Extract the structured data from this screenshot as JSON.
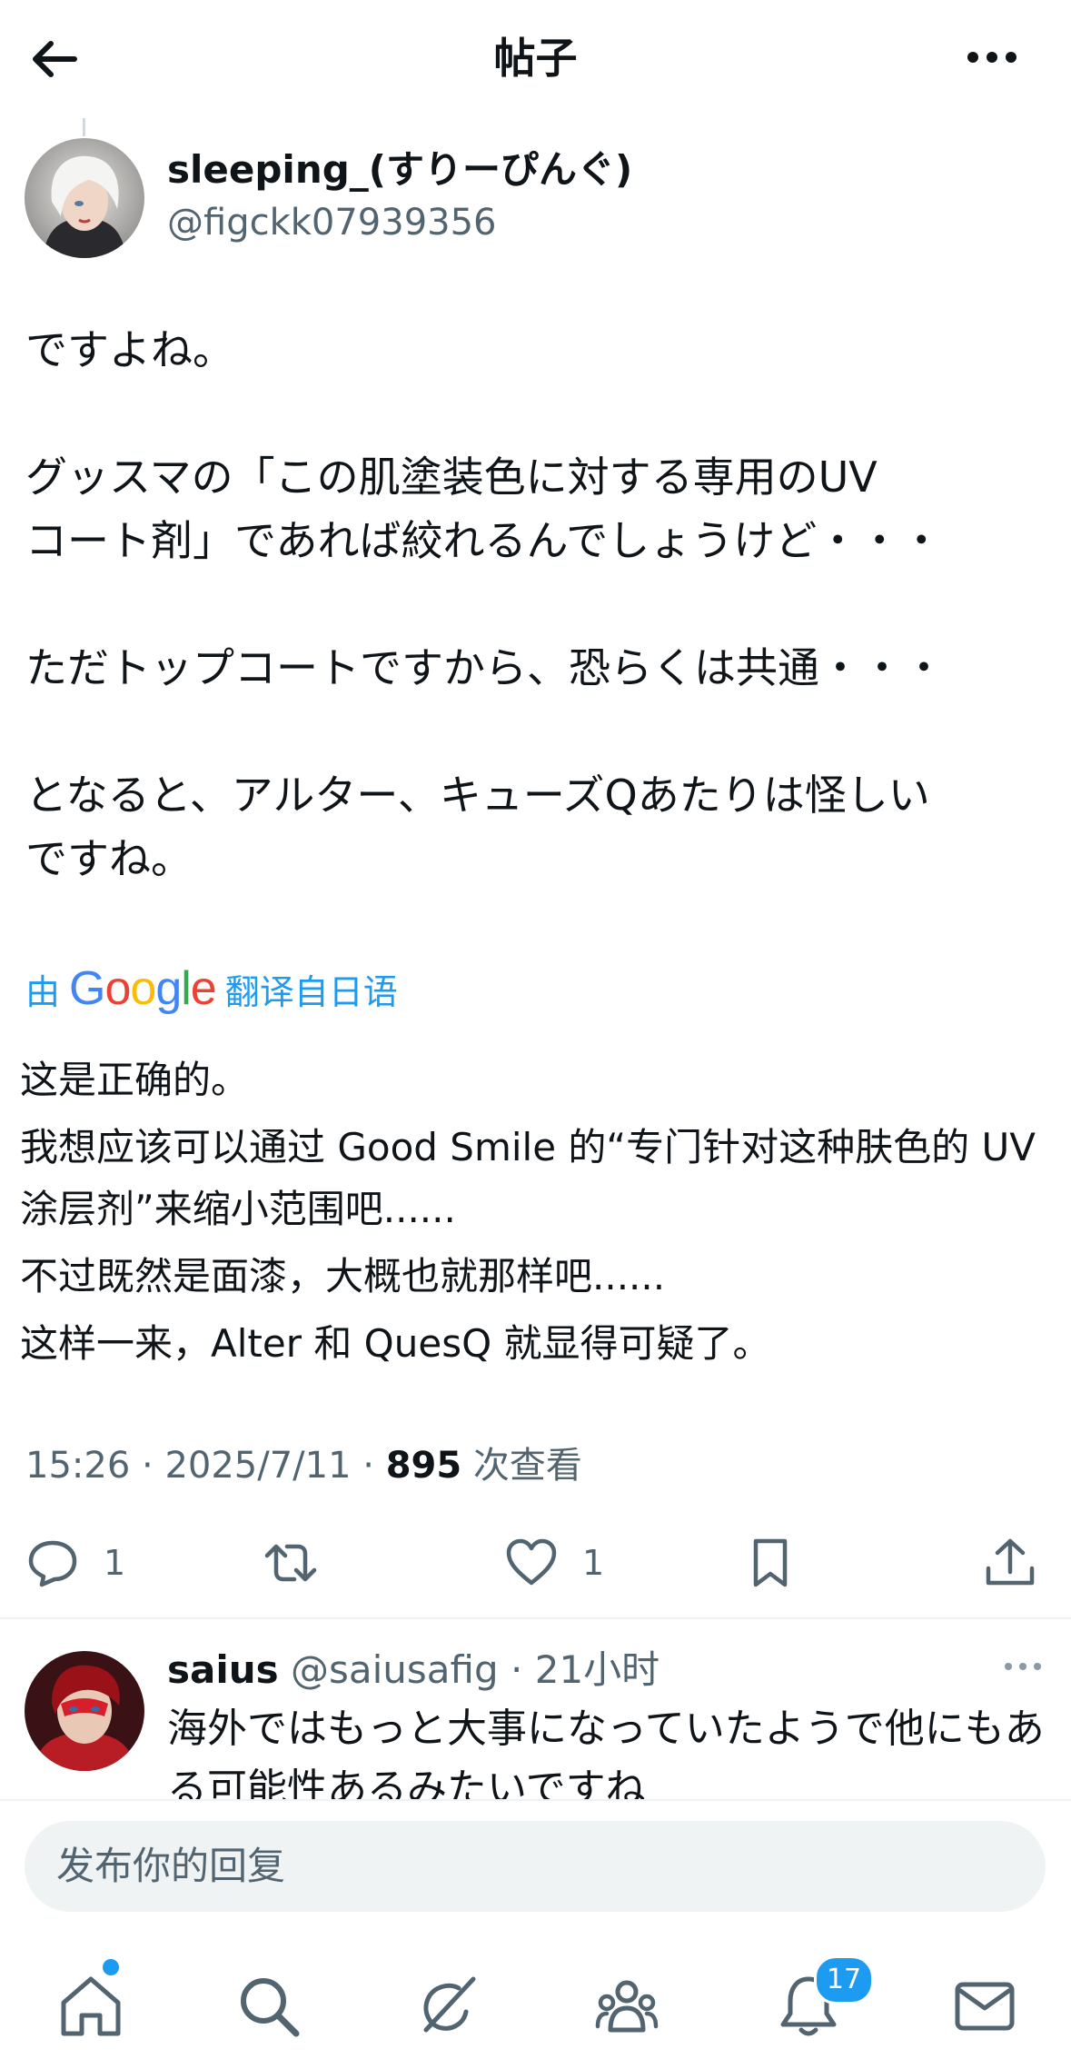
{
  "header": {
    "title": "帖子",
    "back_icon": "arrow-left-icon",
    "more_icon": "more-horizontal-icon"
  },
  "tweet": {
    "author_name": "sleeping_(すりーぴんぐ)",
    "author_handle": "@figckk07939356",
    "text_lines": [
      "ですよね。",
      "",
      "グッスマの「この肌塗装色に対する専用のUV",
      "コート剤」であれば絞れるんでしょうけど・・・",
      "",
      "ただトップコートですから、恐らくは共通・・・",
      "",
      "となると、アルター、キューズQあたりは怪しい",
      "ですね。"
    ],
    "translate_prefix": "由",
    "translate_brand": "Google",
    "translate_suffix": "翻译自日语",
    "translation": [
      "这是正确的。",
      "我想应该可以通过 Good Smile 的“专门针对这种肤色的 UV 涂层剂”来缩小范围吧......",
      "不过既然是面漆，大概也就那样吧......",
      "这样一来，Alter 和 QuesQ 就显得可疑了。"
    ],
    "time": "15:26",
    "date": "2025/7/11",
    "views": "895",
    "views_label": "次查看",
    "actions": {
      "reply_count": "1",
      "retweet_count": "",
      "like_count": "1"
    }
  },
  "reply": {
    "name": "saius",
    "handle": "@saiusafig",
    "time": "21小时",
    "text": "海外ではもっと大事になっていたようで他にもある可能性あるみたいですね"
  },
  "compose": {
    "placeholder": "发布你的回复"
  },
  "nav": {
    "items": [
      "home-icon",
      "search-icon",
      "grok-icon",
      "communities-icon",
      "notifications-icon",
      "messages-icon"
    ],
    "notification_badge": "17"
  },
  "colors": {
    "accent": "#1d9bf0",
    "text": "#0f1419",
    "secondary": "#536471",
    "divider": "#eff3f4"
  }
}
